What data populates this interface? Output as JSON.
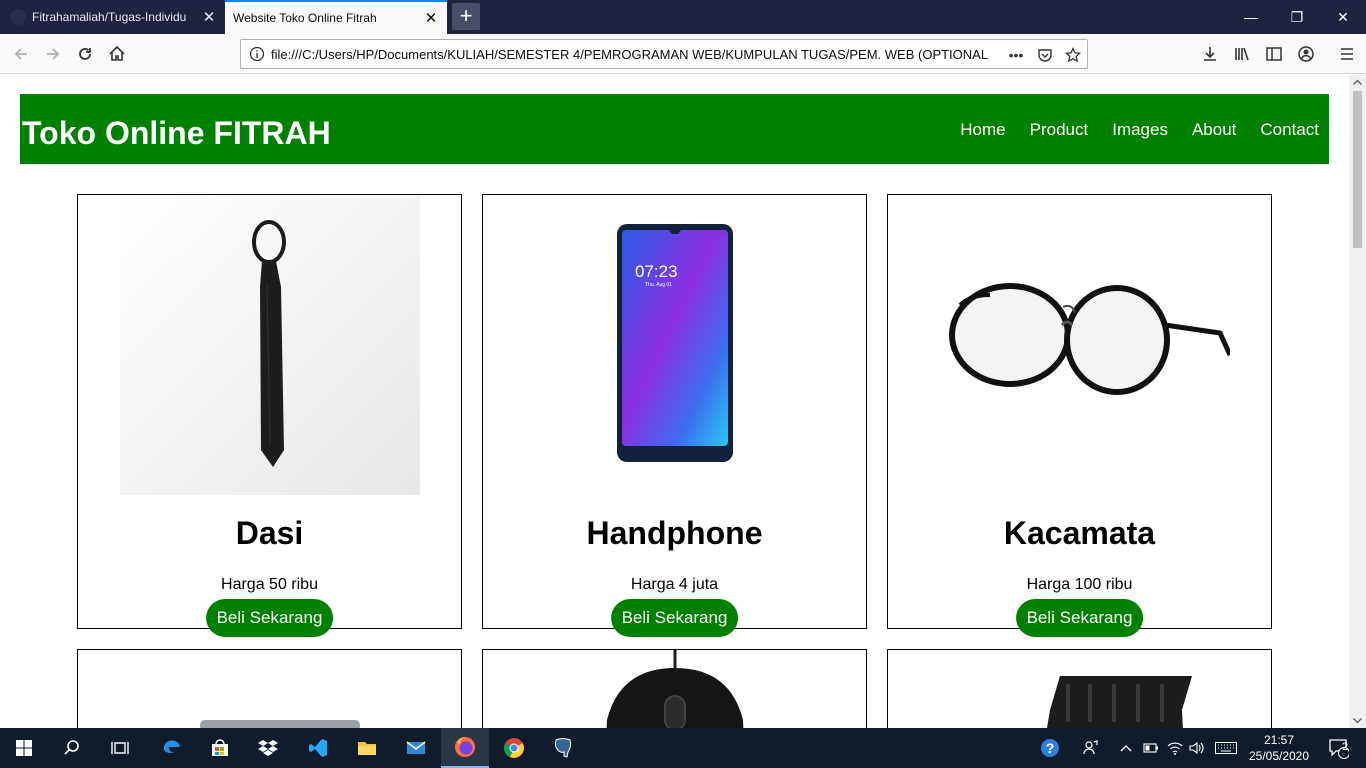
{
  "browser": {
    "tabs": [
      {
        "label": "Fitrahamaliah/Tugas-Individu",
        "close": "✕"
      },
      {
        "label": "Website Toko Online Fitrah",
        "close": "✕"
      }
    ],
    "new_tab": "+",
    "window_controls": {
      "minimize": "—",
      "restore": "❐",
      "close": "✕"
    },
    "url": "file:///C:/Users/HP/Documents/KULIAH/SEMESTER 4/PEMROGRAMAN WEB/KUMPULAN TUGAS/PEM. WEB (OPTIONAL",
    "url_more": "•••"
  },
  "site": {
    "title": "Toko Online FITRAH",
    "nav": [
      "Home",
      "Product",
      "Images",
      "About",
      "Contact"
    ],
    "button_label": "Beli Sekarang",
    "products": [
      {
        "name": "Dasi",
        "price": "Harga 50 ribu"
      },
      {
        "name": "Handphone",
        "price": "Harga 4 juta"
      },
      {
        "name": "Kacamata",
        "price": "Harga 100 ribu"
      }
    ]
  },
  "clock": {
    "time": "21:57",
    "date": "25/05/2020"
  },
  "tray": {
    "notifications": "2"
  },
  "colors": {
    "brand": "#008000",
    "tab_strip": "#202340",
    "taskbar": "#101c2c"
  }
}
